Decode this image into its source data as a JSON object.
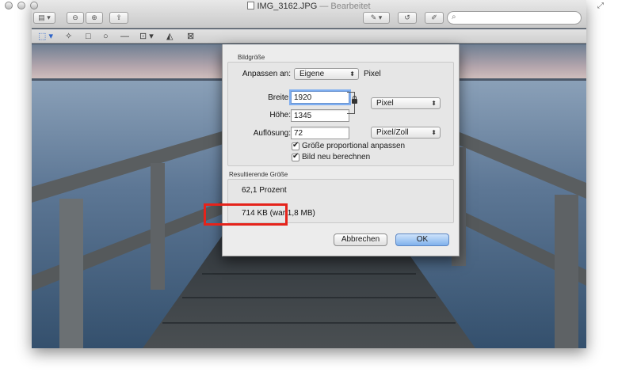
{
  "window": {
    "title": "IMG_3162.JPG",
    "subtitle": "— Bearbeitet"
  },
  "toolbar": {
    "search_placeholder": ""
  },
  "dialog": {
    "group_size_title": "Bildgröße",
    "fit_label": "Anpassen an:",
    "fit_value": "Eigene",
    "fit_unit": "Pixel",
    "width_label": "Breite:",
    "width_value": "1920",
    "height_label": "Höhe:",
    "height_value": "1345",
    "unit_popup": "Pixel",
    "resolution_label": "Auflösung:",
    "resolution_value": "72",
    "resolution_unit": "Pixel/Zoll",
    "scale_proportional": "Größe proportional anpassen",
    "resample": "Bild neu berechnen",
    "result_title": "Resultierende Größe",
    "result_percent": "62,1 Prozent",
    "result_size": "714 KB (war 1,8 MB)",
    "cancel_label": "Abbrechen",
    "ok_label": "OK"
  },
  "colors": {
    "highlight": "#e5231b",
    "default_button": "#7fb1ec"
  }
}
